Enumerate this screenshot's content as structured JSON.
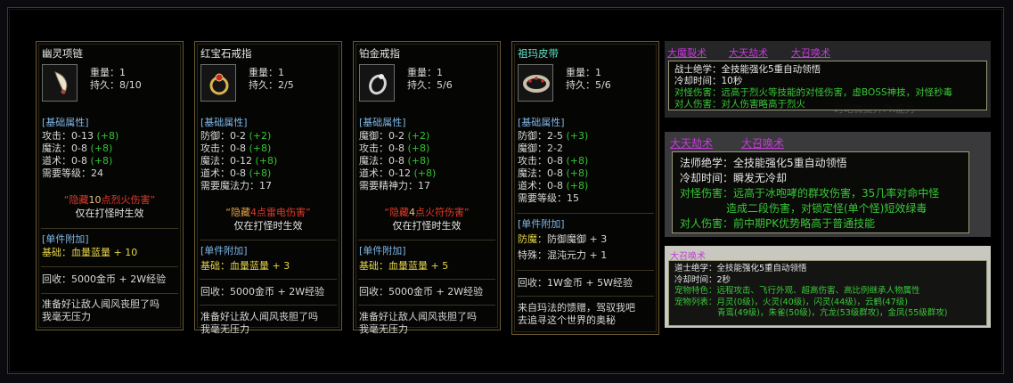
{
  "cards": [
    {
      "name": "幽灵项链",
      "weight": "重量：1",
      "durability": "持久：8/10",
      "section": "[基础属性]",
      "stats": [
        {
          "label": "攻击：0-13",
          "bonus": "(+8)"
        },
        {
          "label": "魔法：0-8",
          "bonus": "(+8)"
        },
        {
          "label": "道术：0-8",
          "bonus": "(+8)"
        },
        {
          "label": "需要等级：24",
          "bonus": ""
        }
      ],
      "hidden_pre": "“隐藏",
      "hidden_num": "10",
      "hidden_post": "点烈火伤害”",
      "hidden_note": "仅在打怪时生效",
      "extra_section": "[单件附加]",
      "extra": [
        {
          "key": "基础：",
          "value": "血量蓝量 + 10"
        }
      ],
      "recycle": "回收：5000金币 + 2W经验",
      "desc": [
        "准备好让敌人闻风丧胆了吗",
        "我毫无压力"
      ]
    },
    {
      "name": "红宝石戒指",
      "weight": "重量：1",
      "durability": "持久：2/5",
      "section": "[基础属性]",
      "stats": [
        {
          "label": "防御：0-2",
          "bonus": "(+2)"
        },
        {
          "label": "攻击：0-8",
          "bonus": "(+8)"
        },
        {
          "label": "魔法：0-12",
          "bonus": "(+8)"
        },
        {
          "label": "道术：0-8",
          "bonus": "(+8)"
        },
        {
          "label": "需要魔法力：17",
          "bonus": ""
        }
      ],
      "hidden_pre": "“隐藏",
      "hidden_num": "4",
      "hidden_post": "点雷电伤害”",
      "hidden_note": "仅在打怪时生效",
      "extra_section": "[单件附加]",
      "extra": [
        {
          "key": "基础：",
          "value": "血量蓝量 + 3"
        }
      ],
      "recycle": "回收：5000金币 + 2W经验",
      "desc": [
        "准备好让敌人闻风丧胆了吗",
        "我毫无压力"
      ]
    },
    {
      "name": "铂金戒指",
      "weight": "重量：1",
      "durability": "持久：5/6",
      "section": "[基础属性]",
      "stats": [
        {
          "label": "魔御：0-2",
          "bonus": "(+2)"
        },
        {
          "label": "攻击：0-8",
          "bonus": "(+8)"
        },
        {
          "label": "魔法：0-8",
          "bonus": "(+8)"
        },
        {
          "label": "道术：0-12",
          "bonus": "(+8)"
        },
        {
          "label": "需要精神力：17",
          "bonus": ""
        }
      ],
      "hidden_pre": "“隐藏",
      "hidden_num": "4",
      "hidden_post": "点火符伤害”",
      "hidden_note": "仅在打怪时生效",
      "extra_section": "[单件附加]",
      "extra": [
        {
          "key": "基础：",
          "value": "血量蓝量 + 5"
        }
      ],
      "recycle": "回收：5000金币 + 2W经验",
      "desc": [
        "准备好让敌人闻风丧胆了吗",
        "我毫无压力"
      ]
    },
    {
      "name": "祖玛皮带",
      "weight": "重量：1",
      "durability": "持久：5/6",
      "section": "[基础属性]",
      "stats": [
        {
          "label": "防御：2-5",
          "bonus": "(+3)"
        },
        {
          "label": "魔御：2-2",
          "bonus": ""
        },
        {
          "label": "攻击：0-8",
          "bonus": "(+8)"
        },
        {
          "label": "魔法：0-8",
          "bonus": "(+8)"
        },
        {
          "label": "道术：0-8",
          "bonus": "(+8)"
        },
        {
          "label": "需要等级：15",
          "bonus": ""
        }
      ],
      "extra_section": "[单件附加]",
      "extra": [
        {
          "key": "防魔：",
          "value": "防御魔御 + 3"
        },
        {
          "key": "特殊：",
          "value": "混沌元力 + 1"
        }
      ],
      "recycle": "回收：1W金币 + 5W经验",
      "desc": [
        "来自玛法的馈赠，驾驭我吧",
        "去追寻这个世界的奥秘"
      ]
    }
  ],
  "panels": {
    "warrior": {
      "tabs": [
        "大魔裂术",
        "大天劫术",
        "大召唤术"
      ],
      "title": "战士绝学：全技能强化5重自动领悟",
      "cooldown": "冷却时间：10秒",
      "pvm": "对怪伤害：远高于烈火等技能的对怪伤害，虚BOSS神技，对怪秒毒",
      "pvp": "对人伤害：对人伤害略高于烈火",
      "ghost": "时略微提升PK能力"
    },
    "mage": {
      "tabs": [
        "大天劫术",
        "大召唤术"
      ],
      "title": "法师绝学：全技能强化5重自动领悟",
      "cooldown": "冷却时间：瞬发无冷却",
      "pvm1": "对怪伤害：远高于冰咆哮的群攻伤害，35几率对命中怪",
      "pvm2": "造成二段伤害，对锁定怪(单个怪)短效绿毒",
      "pvp": "对人伤害：前中期PK优势略高于普通技能"
    },
    "taoist": {
      "tabs": [
        "大召唤术"
      ],
      "title": "道士绝学：全技能强化5重自动领悟",
      "cooldown": "冷却时间：2秒",
      "feature": "宠物特色：远程攻击、飞行外观、超高伤害、高比例继承人物属性",
      "list1": "宠物列表：月灵(0级)，火灵(40级)，闪灵(44级)，云鹤(47级)",
      "list2": "青鸾(49级)，朱雀(50级)，亢龙(53级群攻)，金凤(55级群攻)"
    }
  },
  "colors": {
    "gold_border": "#6b5a2f",
    "green": "#33c433",
    "blue_section": "#7fb6e6",
    "red_hidden": "#e23a2a",
    "purple_tab": "#c43ad8"
  }
}
